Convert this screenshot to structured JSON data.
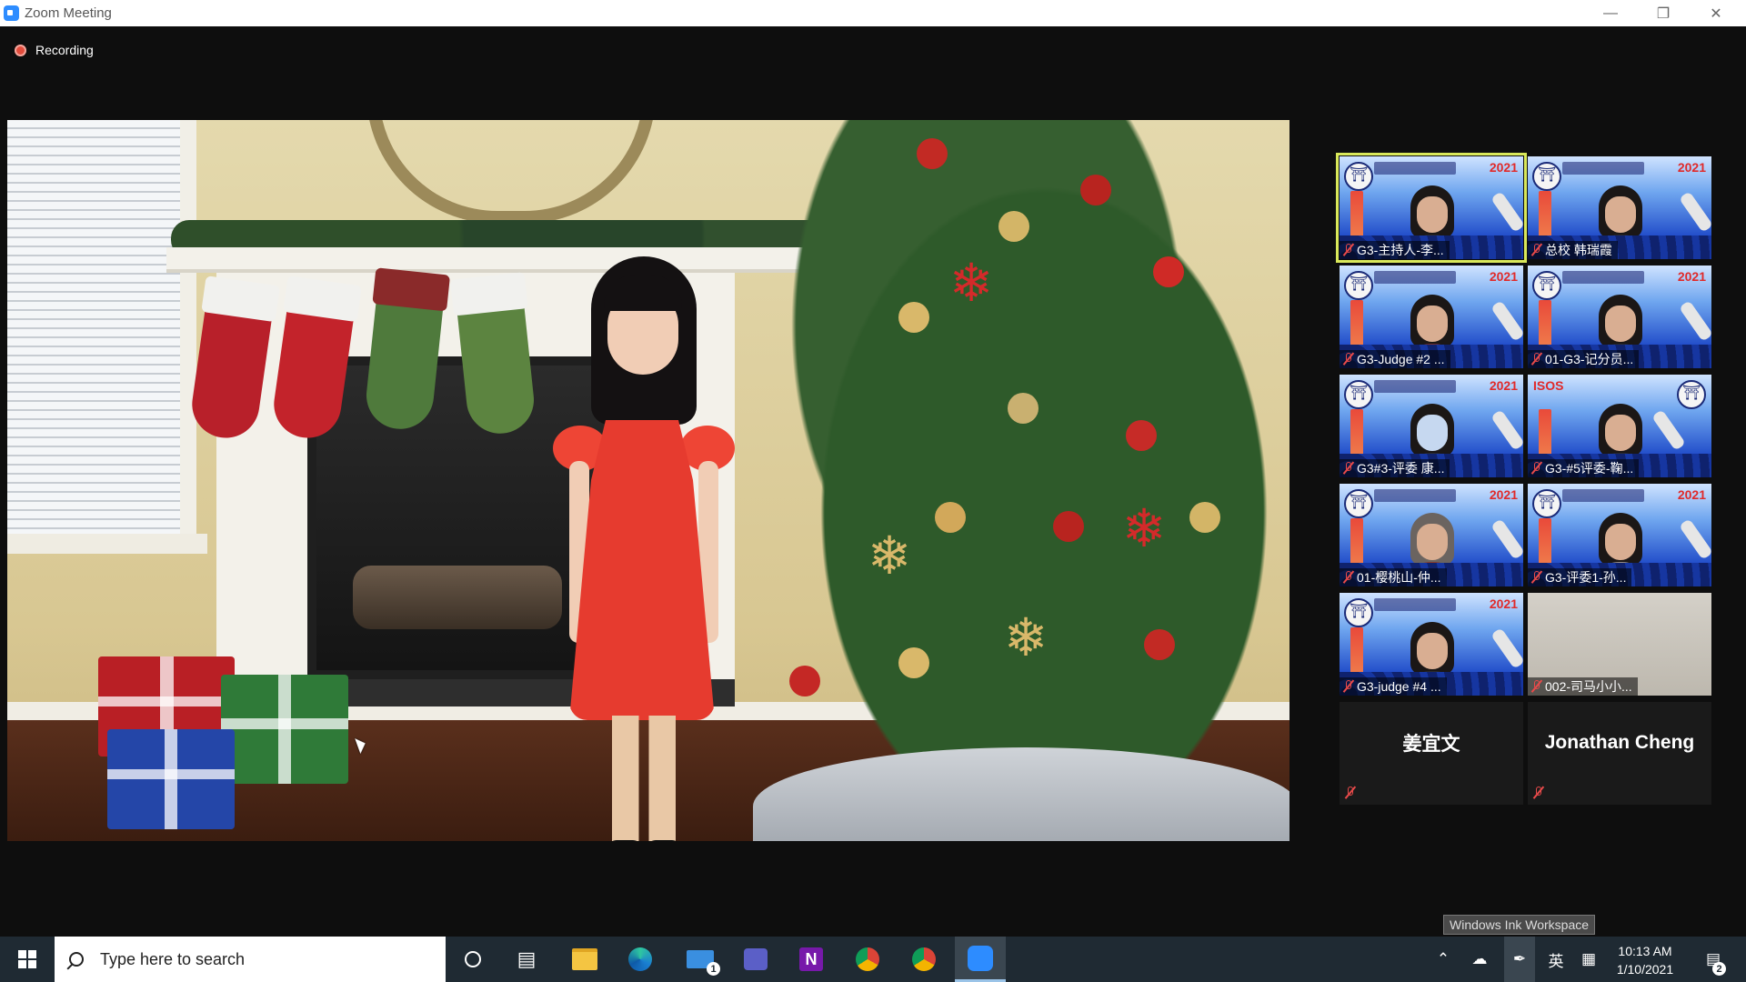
{
  "window": {
    "title": "Zoom Meeting"
  },
  "recording": {
    "label": "Recording"
  },
  "gallery": [
    {
      "name": "G3-主持人-李...",
      "type": "banner",
      "active": true
    },
    {
      "name": "总校 韩瑞霞",
      "type": "banner"
    },
    {
      "name": "G3-Judge #2 ...",
      "type": "banner"
    },
    {
      "name": "01-G3-记分员...",
      "type": "banner"
    },
    {
      "name": "G3#3-评委 康...",
      "type": "banner"
    },
    {
      "name": "G3-#5评委-鞠...",
      "type": "banner",
      "year": "ISOS"
    },
    {
      "name": "01-樱桃山-仲...",
      "type": "banner"
    },
    {
      "name": "G3-评委1-孙...",
      "type": "banner"
    },
    {
      "name": "G3-judge #4 ...",
      "type": "banner"
    },
    {
      "name": "002-司马小小...",
      "type": "plain"
    },
    {
      "name": "姜宜文",
      "type": "dark"
    },
    {
      "name": "Jonathan Cheng",
      "type": "dark"
    }
  ],
  "banner_year": "2021",
  "tooltip": "Windows Ink Workspace",
  "taskbar": {
    "search_placeholder": "Type here to search",
    "apps": [
      "cortana",
      "task-view",
      "file-explorer",
      "edge",
      "mail",
      "teams",
      "onenote",
      "chrome",
      "chrome-profile",
      "zoom"
    ],
    "mail_badge": "1",
    "time": "10:13 AM",
    "date": "1/10/2021",
    "ime": "英",
    "notification_count": "2"
  }
}
